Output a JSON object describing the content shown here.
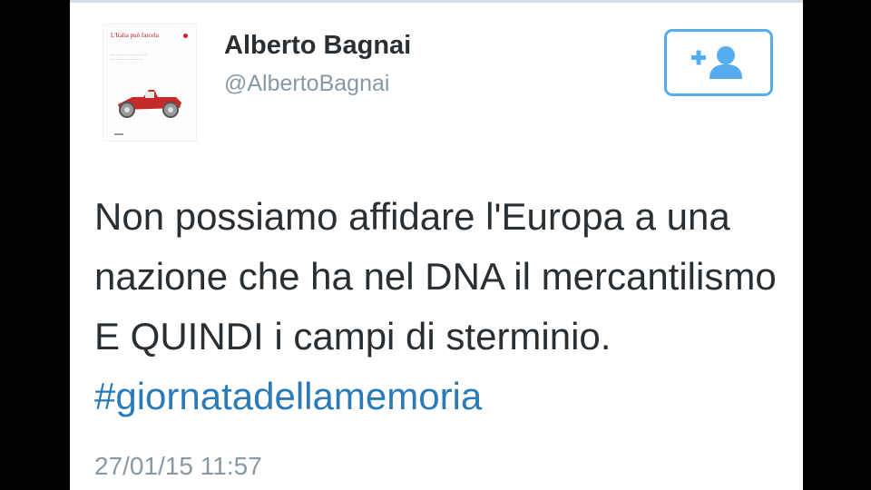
{
  "tweet": {
    "display_name": "Alberto Bagnai",
    "handle": "@AlbertoBagnai",
    "avatar": {
      "book_title": "L'Italia può farcela",
      "icon": "book-cover-red-car"
    },
    "follow_button": {
      "icon": "add-user-icon",
      "color": "#55acee"
    },
    "text": "Non possiamo affidare l'Europa a una nazione che ha nel DNA il mercantilismo E QUINDI i campi di sterminio. ",
    "hashtag": "#giornatadellamemoria",
    "timestamp": "27/01/15 11:57",
    "colors": {
      "text": "#292f33",
      "secondary": "#8899a6",
      "hashtag": "#2b7bb9"
    }
  }
}
